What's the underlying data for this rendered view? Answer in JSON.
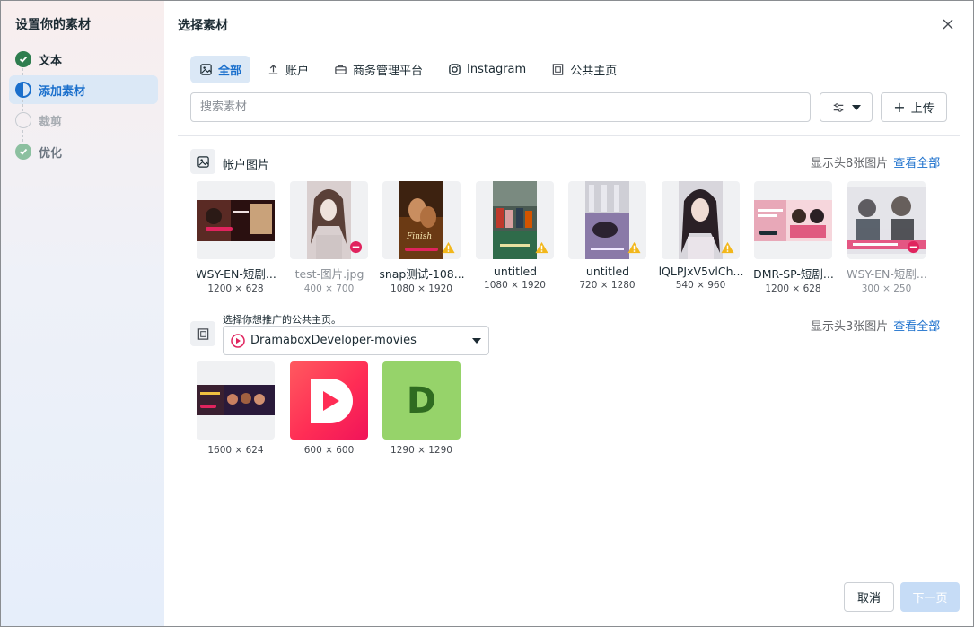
{
  "sidebar": {
    "title": "设置你的素材",
    "steps": [
      {
        "label": "文本",
        "state": "done"
      },
      {
        "label": "添加素材",
        "state": "active"
      },
      {
        "label": "裁剪",
        "state": "todo"
      },
      {
        "label": "优化",
        "state": "done-faded"
      }
    ]
  },
  "dialog": {
    "title": "选择素材",
    "close_icon": "close-icon"
  },
  "tabs": [
    {
      "label": "全部",
      "icon": "image-icon",
      "active": true
    },
    {
      "label": "账户",
      "icon": "upload-icon",
      "active": false
    },
    {
      "label": "商务管理平台",
      "icon": "briefcase-icon",
      "active": false
    },
    {
      "label": "Instagram",
      "icon": "instagram-icon",
      "active": false
    },
    {
      "label": "公共主页",
      "icon": "page-icon",
      "active": false
    }
  ],
  "search": {
    "placeholder": "搜索素材",
    "value": ""
  },
  "toolbar": {
    "upload_label": "上传",
    "upload_prefix": "+"
  },
  "account_images": {
    "title": "帐户图片",
    "meta": "显示头8张图片",
    "link": "查看全部",
    "items": [
      {
        "name": "WSY-EN-短剧...",
        "size": "1200 × 628",
        "muted": false,
        "badge": ""
      },
      {
        "name": "test-图片.jpg",
        "size": "400 × 700",
        "muted": true,
        "badge": "error"
      },
      {
        "name": "snap测试-108...",
        "size": "1080 × 1920",
        "muted": false,
        "badge": "warning"
      },
      {
        "name": "untitled",
        "size": "1080 × 1920",
        "muted": false,
        "badge": "warning"
      },
      {
        "name": "untitled",
        "size": "720 × 1280",
        "muted": false,
        "badge": "warning"
      },
      {
        "name": "lQLPJxV5vlCh...",
        "size": "540 × 960",
        "muted": false,
        "badge": "warning"
      },
      {
        "name": "DMR-SP-短剧...",
        "size": "1200 × 628",
        "muted": false,
        "badge": ""
      },
      {
        "name": "WSY-EN-短剧...",
        "size": "300 × 250",
        "muted": true,
        "badge": "error"
      }
    ]
  },
  "page_images": {
    "select_label": "选择你想推广的公共主页。",
    "selected_page": "DramaboxDeveloper-movies",
    "meta": "显示头3张图片",
    "link": "查看全部",
    "items": [
      {
        "size": "1600 × 624"
      },
      {
        "size": "600 × 600"
      },
      {
        "size": "1290 × 1290",
        "letter": "D"
      }
    ]
  },
  "footer": {
    "cancel_label": "取消",
    "next_label": "下一页"
  },
  "colors": {
    "accent": "#1a6fcc",
    "done": "#2e7d4f",
    "warning": "#f2b71b",
    "error": "#e0245e"
  }
}
